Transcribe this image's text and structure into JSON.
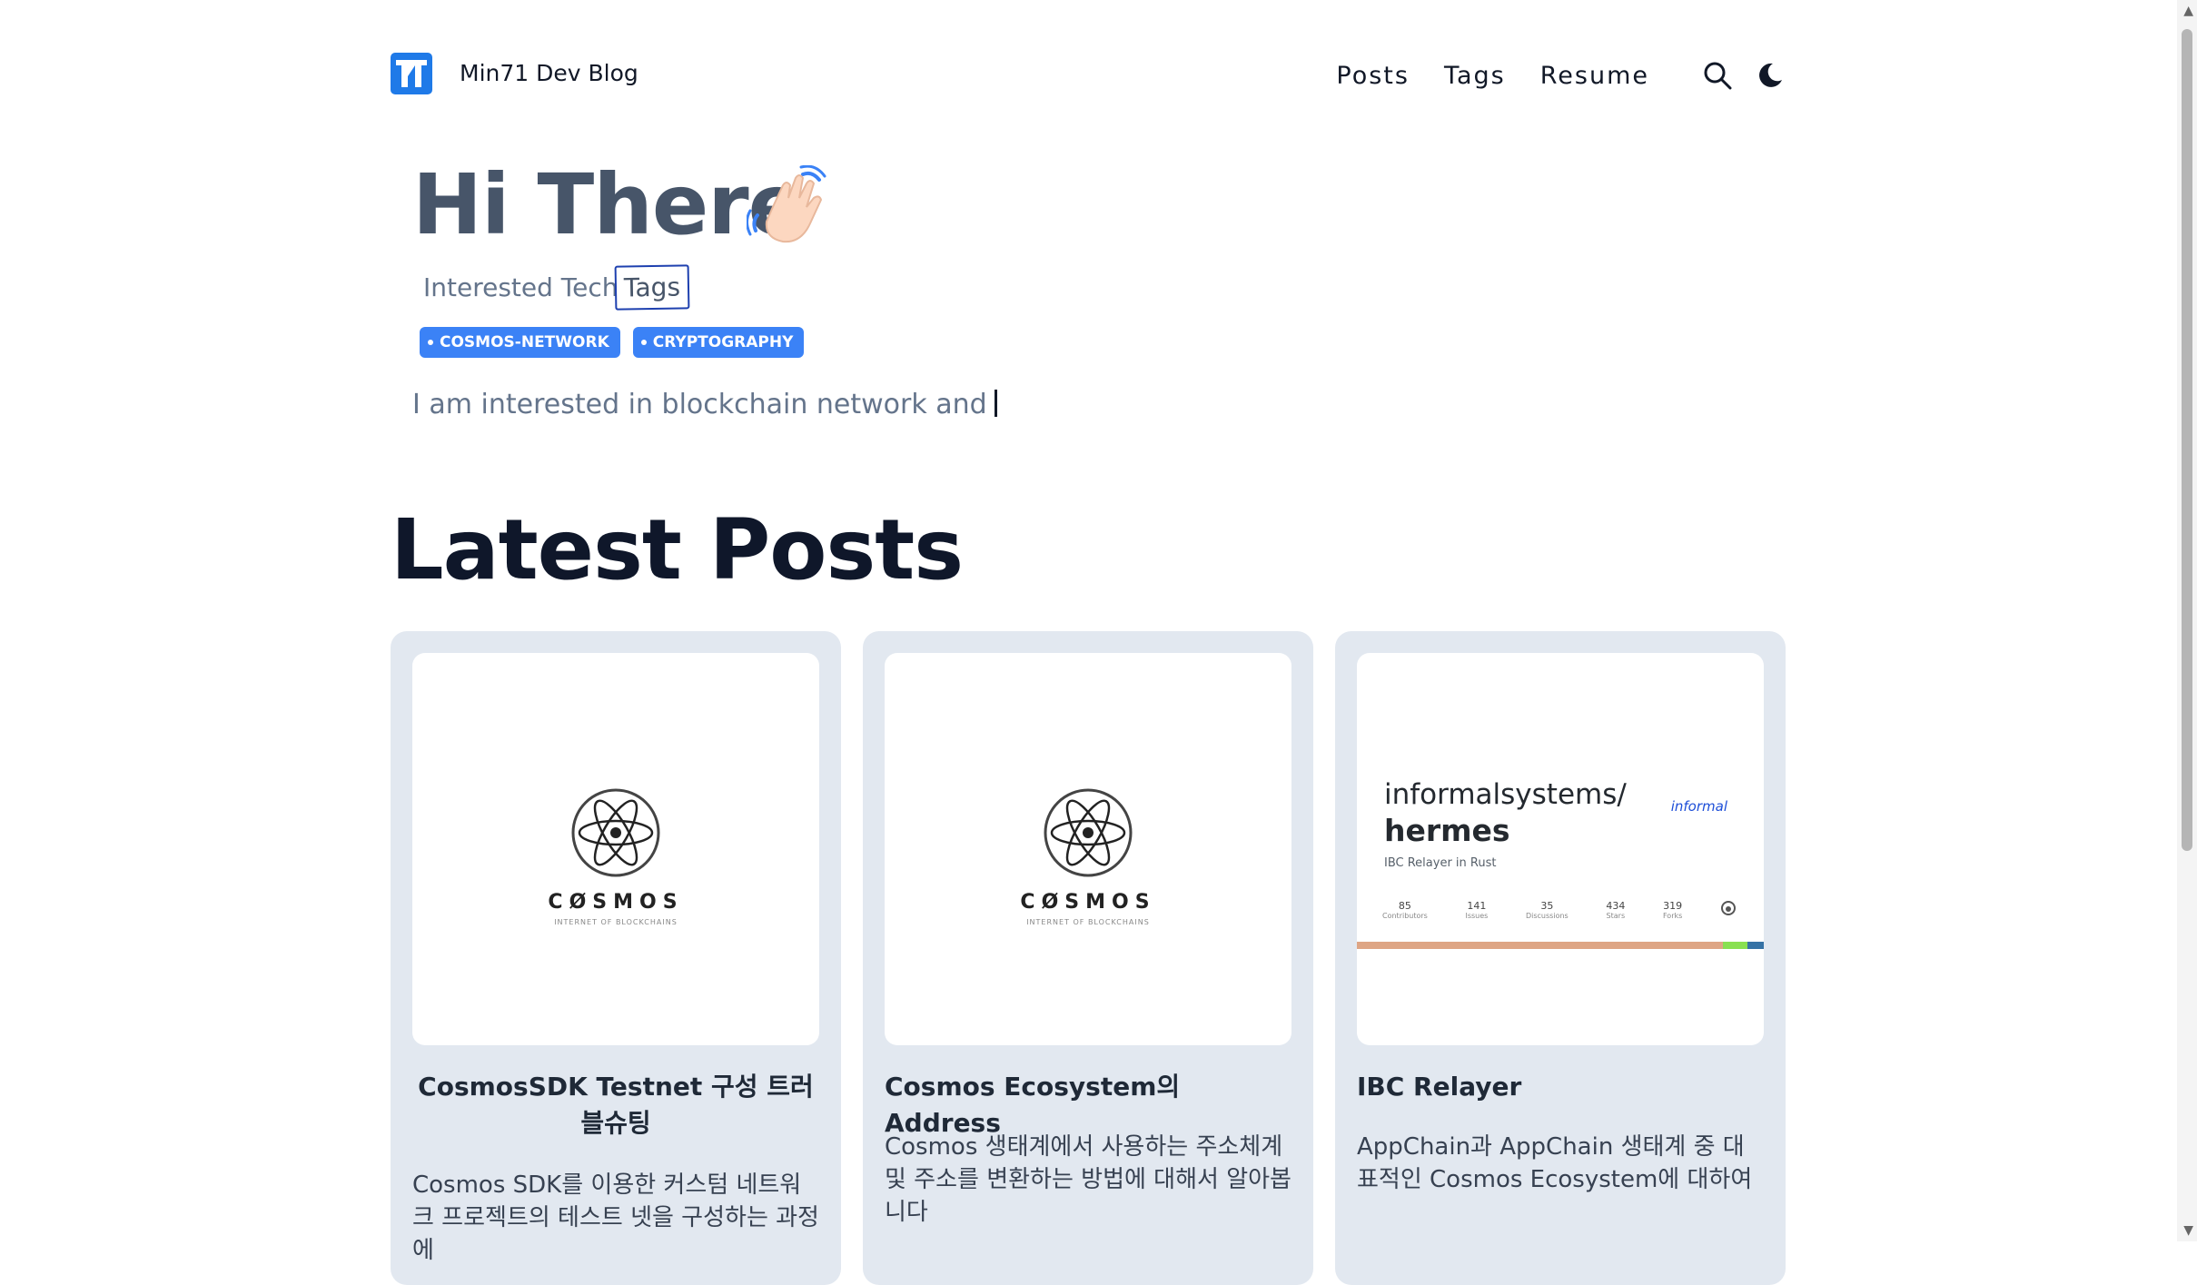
{
  "header": {
    "site_title": "Min71 Dev Blog",
    "nav": [
      {
        "label": "Posts"
      },
      {
        "label": "Tags"
      },
      {
        "label": "Resume"
      }
    ],
    "icons": [
      "logo-icon",
      "search-icon",
      "moon-icon"
    ]
  },
  "hero": {
    "title": "Hi There",
    "emoji": "waving-hand",
    "interest_label": "Interested Tech",
    "interest_tags_word": "Tags",
    "tags": [
      "COSMOS-NETWORK",
      "CRYPTOGRAPHY"
    ],
    "typed_text": "I am interested in blockchain network and"
  },
  "latest": {
    "heading": "Latest Posts",
    "posts": [
      {
        "title": "CosmosSDK Testnet 구성 트러블슈팅",
        "description": "Cosmos SDK를 이용한 커스텀 네트워크 프로젝트의 테스트 넷을 구성하는 과정에",
        "thumb": {
          "brand": "CØSMOS",
          "sub": "INTERNET OF BLOCKCHAINS"
        }
      },
      {
        "title": "Cosmos Ecosystem의 Address",
        "description": "Cosmos 생태계에서 사용하는 주소체계 및 주소를 변환하는 방법에 대해서 알아봅니다",
        "thumb": {
          "brand": "CØSMOS",
          "sub": "INTERNET OF BLOCKCHAINS"
        }
      },
      {
        "title": "IBC Relayer",
        "description": "AppChain과 AppChain 생태계 중 대표적인 Cosmos Ecosystem에 대하여",
        "thumb": {
          "repo_owner": "informalsystems/",
          "repo_name": "hermes",
          "repo_desc": "IBC Relayer in Rust",
          "brand": "informal",
          "stats": [
            {
              "value": "85",
              "label": "Contributors"
            },
            {
              "value": "141",
              "label": "Issues"
            },
            {
              "value": "35",
              "label": "Discussions"
            },
            {
              "value": "434",
              "label": "Stars"
            },
            {
              "value": "319",
              "label": "Forks"
            }
          ]
        }
      }
    ]
  },
  "colors": {
    "accent": "#3b82f6",
    "card_bg": "#e2e8f0",
    "hero_title": "#475569"
  }
}
